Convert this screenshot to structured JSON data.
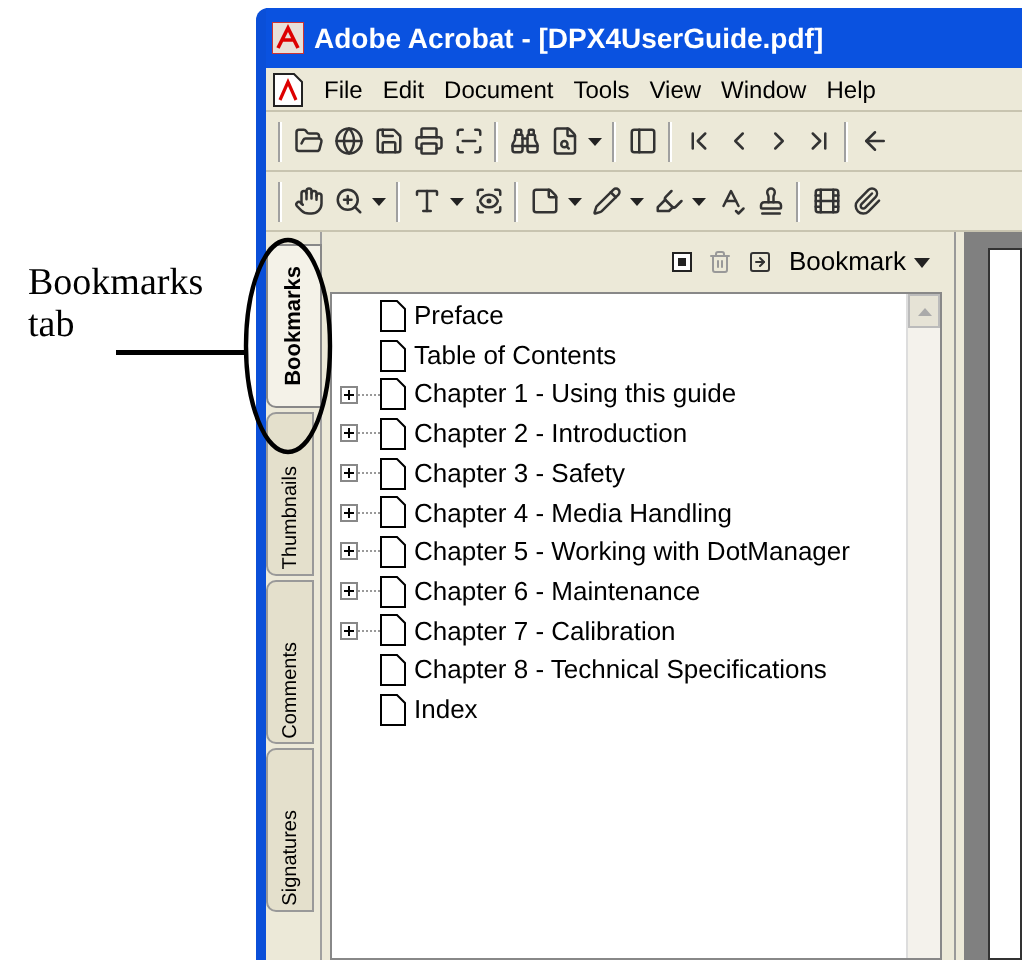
{
  "callout": {
    "label": "Bookmarks tab"
  },
  "window": {
    "title": "Adobe Acrobat - [DPX4UserGuide.pdf]"
  },
  "menu": [
    "File",
    "Edit",
    "Document",
    "Tools",
    "View",
    "Window",
    "Help"
  ],
  "side_tabs": [
    {
      "label": "Bookmarks",
      "selected": true
    },
    {
      "label": "Thumbnails",
      "selected": false
    },
    {
      "label": "Comments",
      "selected": false
    },
    {
      "label": "Signatures",
      "selected": false
    }
  ],
  "panel": {
    "options_label": "Bookmark"
  },
  "bookmarks": [
    {
      "label": "Preface",
      "kind": "leaf"
    },
    {
      "label": "Table of Contents",
      "kind": "leaf"
    },
    {
      "label": "Chapter 1 - Using this guide",
      "kind": "branch"
    },
    {
      "label": "Chapter 2 - Introduction",
      "kind": "branch"
    },
    {
      "label": "Chapter 3 - Safety",
      "kind": "branch"
    },
    {
      "label": "Chapter 4 - Media Handling",
      "kind": "branch"
    },
    {
      "label": "Chapter 5 - Working with DotManager",
      "kind": "branch"
    },
    {
      "label": "Chapter 6 - Maintenance",
      "kind": "branch"
    },
    {
      "label": "Chapter 7 - Calibration",
      "kind": "branch"
    },
    {
      "label": "Chapter 8 - Technical Specifications",
      "kind": "leaf"
    },
    {
      "label": "Index",
      "kind": "leaf"
    }
  ]
}
